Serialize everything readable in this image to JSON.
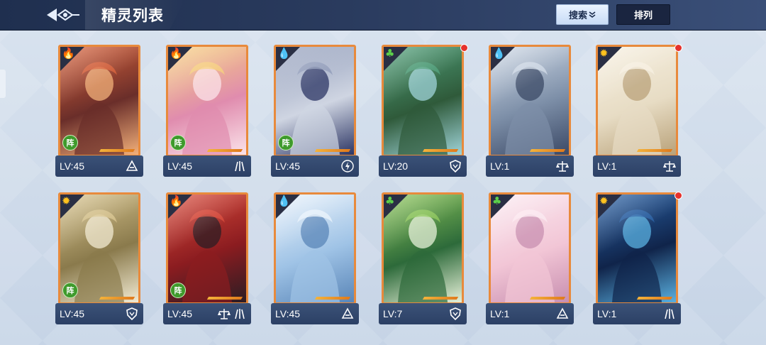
{
  "header": {
    "title": "精灵列表",
    "search_label": "搜索",
    "sort_label": "排列"
  },
  "colors": {
    "fire": "#e03a2a",
    "water": "#2f7fe0",
    "earth": "#46b03a",
    "light": "#f2b21e"
  },
  "cards": [
    {
      "level": "LV:45",
      "element": "fire-icon",
      "formation": "阵",
      "class": "rogue-icon",
      "art": [
        "#6a2e2a",
        "#d9623a",
        "#f2b07a"
      ]
    },
    {
      "level": "LV:45",
      "element": "fire-icon",
      "formation": "阵",
      "class": "claw-icon",
      "art": [
        "#e08cae",
        "#f6d07a",
        "#fbe3ea"
      ]
    },
    {
      "level": "LV:45",
      "element": "water-icon",
      "formation": "阵",
      "class": "lightning-icon",
      "art": [
        "#cfd5e2",
        "#8e9ab8",
        "#2c3564"
      ]
    },
    {
      "level": "LV:20",
      "element": "earth-icon",
      "class": "shield-icon",
      "art": [
        "#2f5a3a",
        "#4fa07a",
        "#9fd3d8"
      ],
      "notice": true
    },
    {
      "level": "LV:1",
      "element": "water-icon",
      "class": "scale-icon",
      "art": [
        "#7d8fa8",
        "#cfd9e6",
        "#3b4966"
      ]
    },
    {
      "level": "LV:1",
      "element": "light-icon",
      "class": "scale-icon",
      "art": [
        "#e7dcc4",
        "#f6efe0",
        "#b9a27a"
      ],
      "notice": true
    },
    {
      "level": "LV:45",
      "element": "light-icon",
      "formation": "阵",
      "class": "shield-icon",
      "art": [
        "#8a7a4c",
        "#d8c48e",
        "#f1ead2"
      ]
    },
    {
      "level": "LV:45",
      "element": "fire-icon",
      "formation": "阵",
      "class": "claw-icon",
      "class2": "scale-icon",
      "art": [
        "#8b1c20",
        "#d94a3a",
        "#2c1d24"
      ]
    },
    {
      "level": "LV:45",
      "element": "water-icon",
      "class": "rogue-icon",
      "art": [
        "#9fc3e6",
        "#e9f2fb",
        "#5a86b8"
      ]
    },
    {
      "level": "LV:7",
      "element": "earth-icon",
      "class": "shield-icon",
      "art": [
        "#2d6a3a",
        "#8fc85a",
        "#e6f0d8"
      ]
    },
    {
      "level": "LV:1",
      "element": "earth-icon",
      "class": "rogue-icon",
      "art": [
        "#f2c6d6",
        "#fbe9f0",
        "#c88fb0"
      ]
    },
    {
      "level": "LV:1",
      "element": "light-icon",
      "class": "claw-icon",
      "art": [
        "#10244a",
        "#2a63a8",
        "#5ab0e0"
      ],
      "notice": true
    }
  ]
}
